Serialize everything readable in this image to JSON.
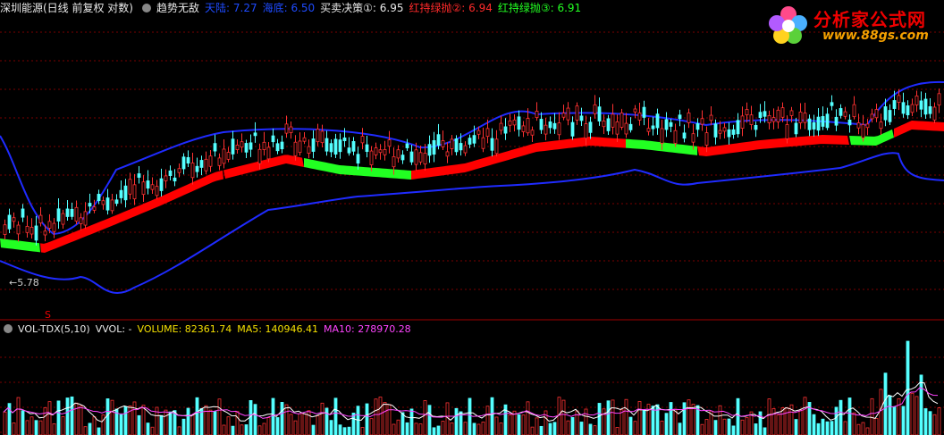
{
  "header": {
    "title": "深圳能源(日线 前复权 对数)",
    "indicator": "趋势无敌",
    "items": [
      {
        "label": "天陆: 7.27",
        "color": "#1e4bff"
      },
      {
        "label": "海底: 6.50",
        "color": "#1e4bff"
      },
      {
        "label": "买卖决策①: 6.95",
        "color": "#e8e8e8"
      },
      {
        "label": "红持绿抛②: 6.94",
        "color": "#ff2a2a"
      },
      {
        "label": "红持绿抛③: 6.91",
        "color": "#22ff22"
      }
    ]
  },
  "volume_header": {
    "name": "VOL-TDX(5,10)",
    "vvol": "VVOL: -",
    "volume": "VOLUME: 82361.74",
    "ma5": "MA5: 140946.41",
    "ma10": "MA10: 278970.28"
  },
  "annotations": {
    "low": "←5.78",
    "signal": "S"
  },
  "logo": {
    "brand": "分析家公式网",
    "url": "www.88gs.com"
  },
  "colors": {
    "up": "#ff3232",
    "down": "#54ffff",
    "band": "#1f2bff",
    "trend_up": "#ff0000",
    "trend_down": "#22ff22",
    "ma5": "#ffffff",
    "ma10": "#ff44ff",
    "grid": "#7a0000"
  }
}
